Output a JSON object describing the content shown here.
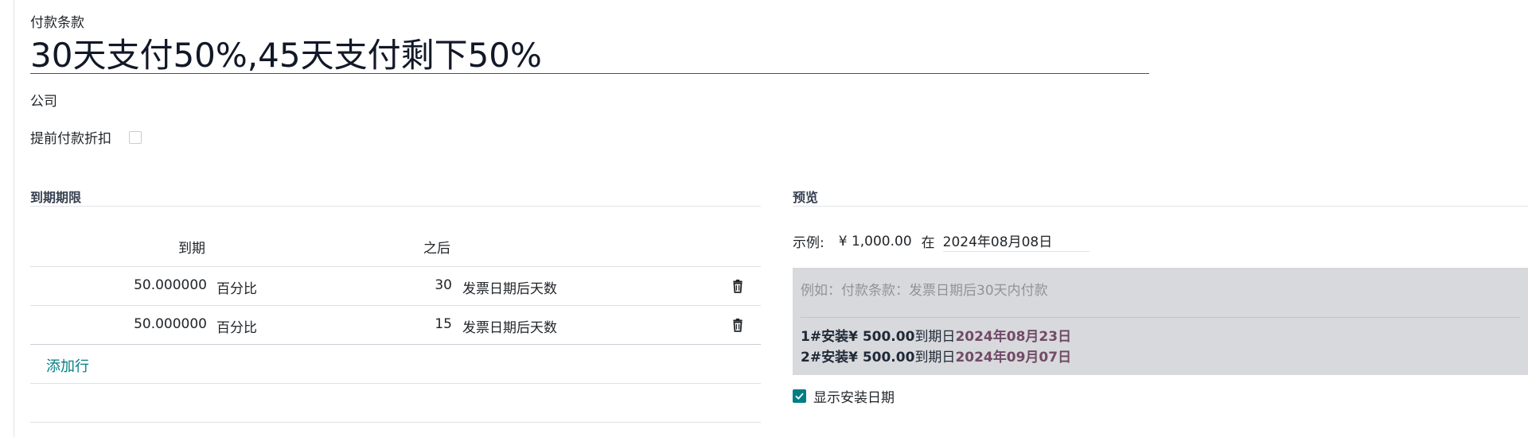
{
  "form": {
    "title_caption": "付款条款",
    "title_value": "30天支付50%,45天支付剩下50%",
    "company_label": "公司",
    "early_discount_label": "提前付款折扣"
  },
  "due_terms": {
    "section_title": "到期期限",
    "columns": {
      "due": "到期",
      "after": "之后"
    },
    "rows": [
      {
        "value": "50.000000",
        "value_type": "百分比",
        "days": "30",
        "delay_type": "发票日期后天数"
      },
      {
        "value": "50.000000",
        "value_type": "百分比",
        "days": "15",
        "delay_type": "发票日期后天数"
      }
    ],
    "add_line_label": "添加行"
  },
  "preview": {
    "section_title": "预览",
    "example_label": "示例:",
    "example_amount": "¥ 1,000.00",
    "in_label": "在",
    "example_date": "2024年08月08日",
    "placeholder_note": "例如：付款条款：发票日期后30天内付款",
    "installments": [
      {
        "prefix": "1#安装",
        "amount": "¥ 500.00",
        "due_text": "到期日",
        "date": "2024年08月23日"
      },
      {
        "prefix": "2#安装",
        "amount": "¥ 500.00",
        "due_text": "到期日",
        "date": "2024年09月07日"
      }
    ],
    "show_dates_label": "显示安装日期",
    "show_dates_checked": true
  },
  "colors": {
    "accent": "#017e84",
    "installment_date": "#714b67",
    "preview_background": "#d8d9dc"
  },
  "icons": {
    "row_delete": "trash-icon",
    "checkbox_checked": "check-icon"
  }
}
